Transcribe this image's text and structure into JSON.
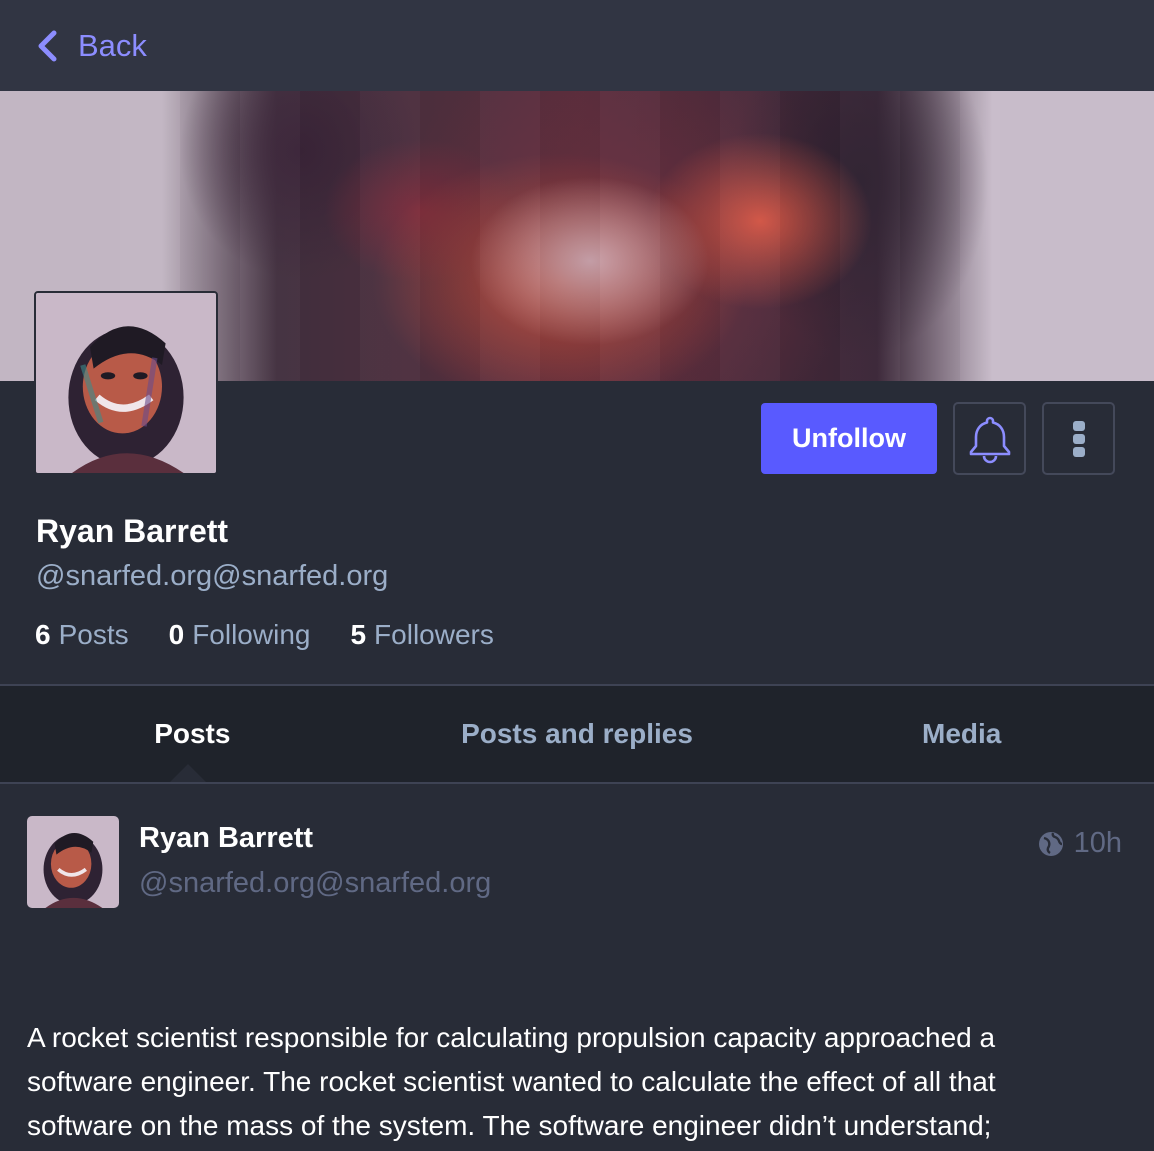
{
  "nav": {
    "back_label": "Back"
  },
  "profile": {
    "display_name": "Ryan Barrett",
    "acct": "@snarfed.org@snarfed.org",
    "counts": [
      {
        "value": "6",
        "label": "Posts"
      },
      {
        "value": "0",
        "label": "Following"
      },
      {
        "value": "5",
        "label": "Followers"
      }
    ],
    "actions": {
      "unfollow_label": "Unfollow"
    }
  },
  "tabs": [
    {
      "label": "Posts",
      "active": true
    },
    {
      "label": "Posts and replies",
      "active": false
    },
    {
      "label": "Media",
      "active": false
    }
  ],
  "post": {
    "display_name": "Ryan Barrett",
    "acct": "@snarfed.org@snarfed.org",
    "time": "10h",
    "visibility_icon": "globe-icon",
    "lines": [
      "A rocket scientist responsible for calculating propulsion capacity approached a",
      "software engineer. The rocket scientist wanted to calculate the effect of all that",
      "software on the mass of the system. The software engineer didn’t understand;"
    ]
  },
  "colors": {
    "background": "#282c37",
    "topbar": "#313543",
    "accent": "#595aff",
    "link": "#8c8dff",
    "secondary_text": "#9baec8",
    "muted_text": "#606984"
  }
}
